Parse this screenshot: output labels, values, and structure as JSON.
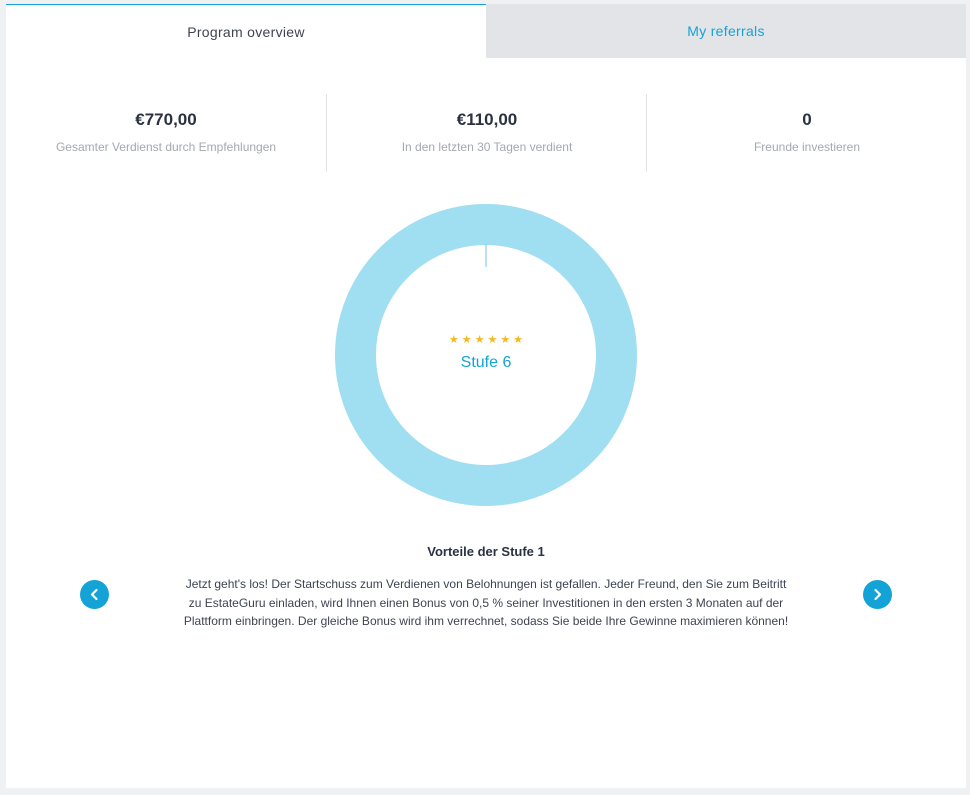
{
  "tabs": [
    {
      "label": "Program overview",
      "active": true
    },
    {
      "label": "My referrals",
      "active": false
    }
  ],
  "stats": [
    {
      "value": "€770,00",
      "label": "Gesamter Verdienst durch Empfehlungen"
    },
    {
      "value": "€110,00",
      "label": "In den letzten 30 Tagen verdient"
    },
    {
      "value": "0",
      "label": "Freunde investieren"
    }
  ],
  "level": {
    "stars": 6,
    "label": "Stufe 6",
    "progress": 0
  },
  "benefit": {
    "title": "Vorteile der Stufe 1",
    "text": "Jetzt geht's los! Der Startschuss zum Verdienen von Belohnungen ist gefallen. Jeder Freund, den Sie zum Beitritt zu EstateGuru einladen, wird Ihnen einen Bonus von 0,5 % seiner Investitionen in den ersten 3 Monaten auf der Plattform einbringen. Der gleiche Bonus wird ihm verrechnet, sodass Sie beide Ihre Gewinne maximieren können!"
  },
  "icons": {
    "prev": "chevron-left-icon",
    "next": "chevron-right-icon",
    "star": "star-icon"
  },
  "colors": {
    "accent": "#14a3d6",
    "ring": "#a0dff2",
    "star": "#f5b91e",
    "tab_inactive_bg": "#e3e4e7"
  }
}
